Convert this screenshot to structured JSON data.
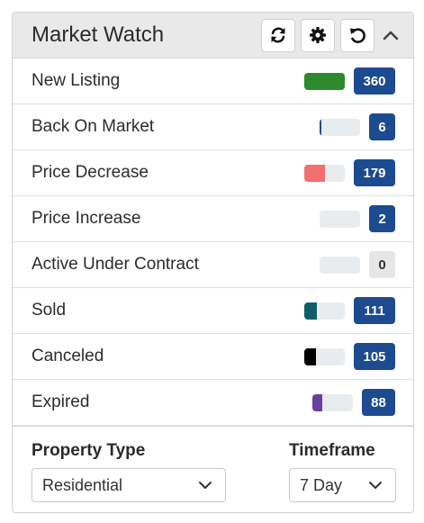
{
  "header": {
    "title": "Market Watch",
    "buttons": [
      {
        "name": "refresh-button",
        "icon": "refresh-icon"
      },
      {
        "name": "settings-button",
        "icon": "gear-icon"
      },
      {
        "name": "reset-button",
        "icon": "undo-icon"
      }
    ],
    "collapse_icon": "chevron-up-icon"
  },
  "rows": [
    {
      "label": "New Listing",
      "count": "360",
      "bar_fraction": 1.0,
      "bar_color": "#2d8a2d",
      "badge_color": "#1d4b8f"
    },
    {
      "label": "Back On Market",
      "count": "6",
      "bar_fraction": 0.02,
      "bar_color": "#1d4b8f",
      "badge_color": "#1d4b8f"
    },
    {
      "label": "Price Decrease",
      "count": "179",
      "bar_fraction": 0.5,
      "bar_color": "#f07070",
      "badge_color": "#1d4b8f"
    },
    {
      "label": "Price Increase",
      "count": "2",
      "bar_fraction": 0.0,
      "bar_color": "#1d4b8f",
      "badge_color": "#1d4b8f"
    },
    {
      "label": "Active Under Contract",
      "count": "0",
      "bar_fraction": 0.0,
      "bar_color": "#999999",
      "badge_color": "#e6e6e6"
    },
    {
      "label": "Sold",
      "count": "111",
      "bar_fraction": 0.3,
      "bar_color": "#0e5d6b",
      "badge_color": "#1d4b8f"
    },
    {
      "label": "Canceled",
      "count": "105",
      "bar_fraction": 0.28,
      "bar_color": "#000000",
      "badge_color": "#1d4b8f"
    },
    {
      "label": "Expired",
      "count": "88",
      "bar_fraction": 0.24,
      "bar_color": "#6b3fa0",
      "badge_color": "#1d4b8f"
    }
  ],
  "filters": {
    "property_type_label": "Property Type",
    "property_type_value": "Residential",
    "timeframe_label": "Timeframe",
    "timeframe_value": "7 Day"
  }
}
